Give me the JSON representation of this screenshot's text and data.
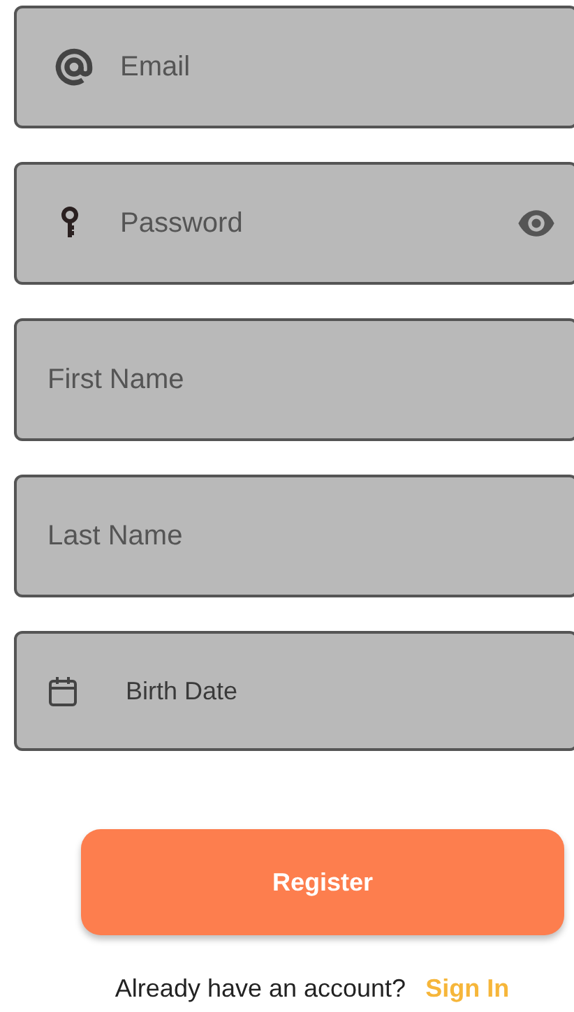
{
  "fields": [
    {
      "kind": "email",
      "placeholder": "Email"
    },
    {
      "kind": "password",
      "placeholder": "Password"
    },
    {
      "kind": "plain",
      "placeholder": "First Name"
    },
    {
      "kind": "plain",
      "placeholder": "Last Name"
    },
    {
      "kind": "date",
      "placeholder": "Birth Date"
    }
  ],
  "register_button": "Register",
  "footer": {
    "prompt": "Already have an account?",
    "link": "Sign In"
  }
}
